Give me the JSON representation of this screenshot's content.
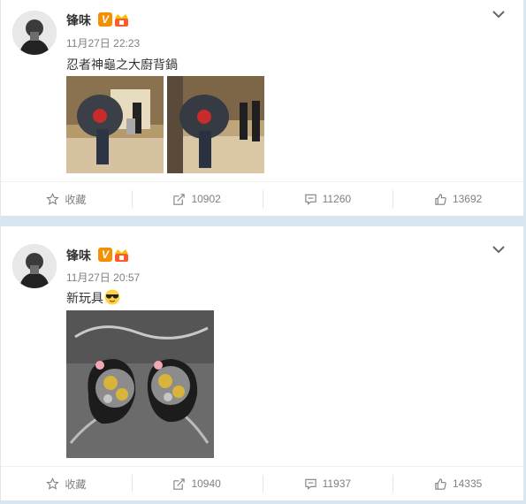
{
  "posts": [
    {
      "author": "锋味",
      "verified_mark": "V",
      "time": "11月27日 22:23",
      "text": "忍者神龜之大廚背鍋",
      "actions": {
        "favorite": "收藏",
        "repost": "10902",
        "comment": "11260",
        "like": "13692"
      }
    },
    {
      "author": "锋味",
      "verified_mark": "V",
      "time": "11月27日 20:57",
      "text": "新玩具",
      "emoji": "sunglasses-emoji",
      "actions": {
        "favorite": "收藏",
        "repost": "10940",
        "comment": "11937",
        "like": "14335"
      }
    }
  ],
  "colors": {
    "badge_orange": "#f38f00",
    "meta_gray": "#808080",
    "background": "#d9e6ef"
  },
  "icons": [
    "star-icon",
    "repost-icon",
    "comment-icon",
    "thumbs-up-icon",
    "chevron-down-icon"
  ]
}
